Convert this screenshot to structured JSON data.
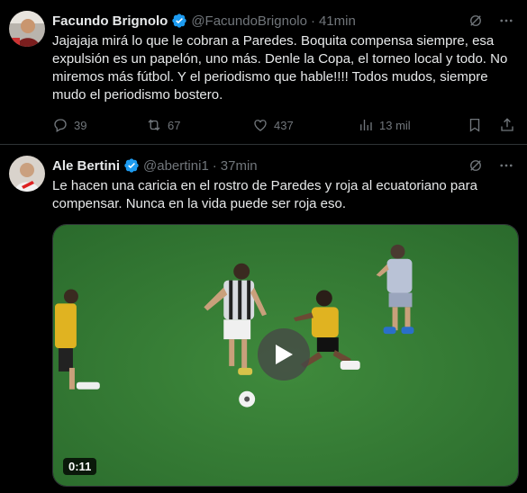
{
  "tweets": [
    {
      "name": "Facundo Brignolo",
      "handle": "@FacundoBrignolo",
      "separator": "·",
      "time": "41min",
      "text": "Jajajaja mirá lo que le cobran a Paredes. Boquita compensa siempre, esa expulsión es un papelón, uno más. Denle la Copa, el torneo local y todo. No miremos más fútbol. Y el periodismo que hable!!!! Todos mudos, siempre mudo el periodismo bostero.",
      "replies": "39",
      "retweets": "67",
      "likes": "437",
      "views": "13 mil"
    },
    {
      "name": "Ale Bertini",
      "handle": "@abertini1",
      "separator": "·",
      "time": "37min",
      "text": "Le hacen una caricia en el rostro de Paredes y roja al ecuatoriano para compensar. Nunca en la vida puede ser roja eso.",
      "video_duration": "0:11"
    }
  ],
  "colors": {
    "accent": "#1d9bf0",
    "muted": "#71767b",
    "text": "#e7e9ea",
    "background": "#000000",
    "border": "#2f3336"
  },
  "icons": [
    "grok-icon",
    "more-icon",
    "reply-icon",
    "retweet-icon",
    "like-icon",
    "views-icon",
    "bookmark-icon",
    "share-icon",
    "verified-badge-icon",
    "play-icon"
  ]
}
